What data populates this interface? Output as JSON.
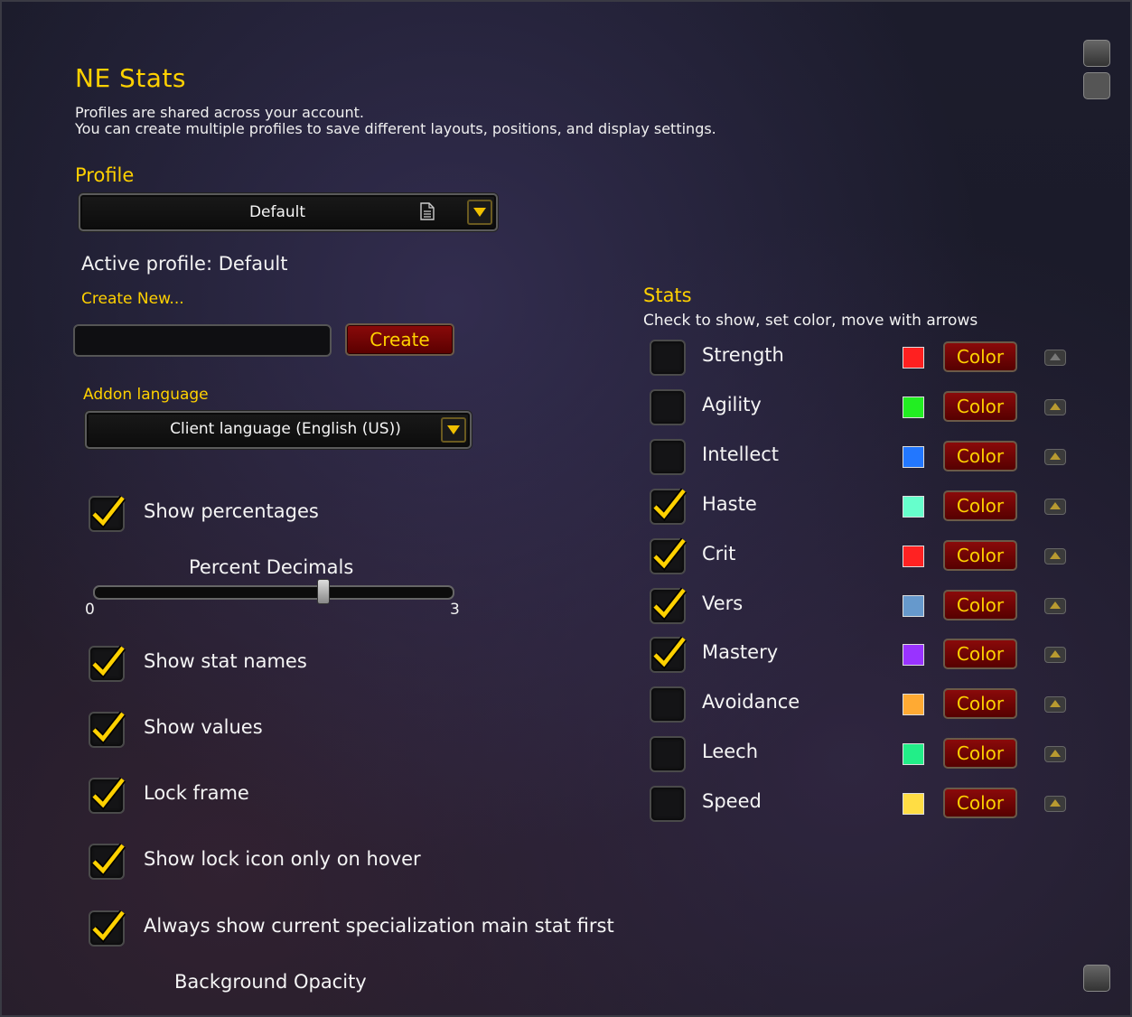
{
  "window": {
    "title": "NE Stats",
    "description_line1": "Profiles are shared across your account.",
    "description_line2": "You can create multiple profiles to save different layouts, positions, and display settings."
  },
  "profile": {
    "heading": "Profile",
    "selected": "Default",
    "active_label": "Active profile: Default",
    "create_new_label": "Create New...",
    "new_name_value": "",
    "create_button": "Create"
  },
  "language": {
    "heading": "Addon language",
    "selected": "Client language (English (US))"
  },
  "options": {
    "show_percentages": {
      "label": "Show percentages",
      "checked": true
    },
    "percent_decimals": {
      "label": "Percent Decimals",
      "min": "0",
      "max": "3",
      "value": 2
    },
    "show_stat_names": {
      "label": "Show stat names",
      "checked": true
    },
    "show_values": {
      "label": "Show values",
      "checked": true
    },
    "lock_frame": {
      "label": "Lock frame",
      "checked": true
    },
    "lock_icon_hover": {
      "label": "Show lock icon only on hover",
      "checked": true
    },
    "main_stat_first": {
      "label": "Always show current specialization main stat first",
      "checked": true
    },
    "background_opacity": {
      "label": "Background Opacity"
    }
  },
  "stats": {
    "heading": "Stats",
    "subheading": "Check to show, set color, move with arrows",
    "color_button": "Color",
    "items": [
      {
        "name": "Strength",
        "checked": false,
        "color": "#ff2020"
      },
      {
        "name": "Agility",
        "checked": false,
        "color": "#22ee22"
      },
      {
        "name": "Intellect",
        "checked": false,
        "color": "#2277ff"
      },
      {
        "name": "Haste",
        "checked": true,
        "color": "#66ffcc"
      },
      {
        "name": "Crit",
        "checked": true,
        "color": "#ff2222"
      },
      {
        "name": "Vers",
        "checked": true,
        "color": "#6699cc"
      },
      {
        "name": "Mastery",
        "checked": true,
        "color": "#9933ff"
      },
      {
        "name": "Avoidance",
        "checked": false,
        "color": "#ffaa33"
      },
      {
        "name": "Leech",
        "checked": false,
        "color": "#22ee88"
      },
      {
        "name": "Speed",
        "checked": false,
        "color": "#ffdd44"
      }
    ]
  },
  "icons": {
    "checkmark": "checkmark-icon",
    "up_arrow": "up-arrow-icon",
    "dropdown": "chevron-down-icon",
    "document": "document-icon"
  }
}
